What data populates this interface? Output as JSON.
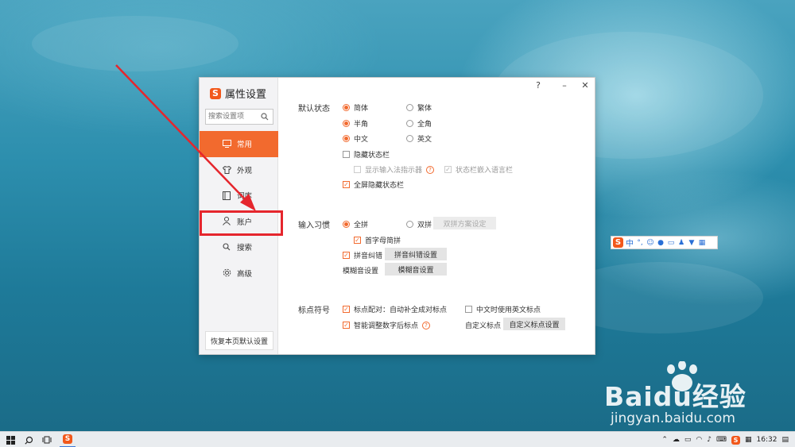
{
  "dialog": {
    "title": "属性设置",
    "help_label": "?",
    "minimize_label": "–",
    "close_label": "✕",
    "search_placeholder": "搜索设置项",
    "nav": [
      {
        "label": "常用",
        "icon": "monitor-icon"
      },
      {
        "label": "外观",
        "icon": "shirt-icon"
      },
      {
        "label": "词库",
        "icon": "book-icon"
      },
      {
        "label": "账户",
        "icon": "user-icon"
      },
      {
        "label": "搜索",
        "icon": "search-icon"
      },
      {
        "label": "高级",
        "icon": "gear-icon"
      }
    ],
    "restore_label": "恢复本页默认设置"
  },
  "default_state": {
    "title": "默认状态",
    "simplified": "简体",
    "traditional": "繁体",
    "half_width": "半角",
    "full_width": "全角",
    "chinese": "中文",
    "english": "英文",
    "hide_status_bar": "隐藏状态栏",
    "show_indicator": "显示输入法指示器",
    "embed_lang_bar": "状态栏嵌入语言栏",
    "fullscreen_hide": "全屏隐藏状态栏"
  },
  "input_habit": {
    "title": "输入习惯",
    "full_pinyin": "全拼",
    "double_pinyin": "双拼",
    "double_scheme_button": "双拼方案设定",
    "initial_abbrev": "首字母简拼",
    "pinyin_correction": "拼音纠错",
    "correction_button": "拼音纠错设置",
    "fuzzy_label": "模糊音设置",
    "fuzzy_button": "模糊音设置"
  },
  "punctuation": {
    "title": "标点符号",
    "auto_pair": "标点配对：自动补全成对标点",
    "english_in_chinese": "中文时使用英文标点",
    "smart_adjust": "智能调整数字后标点",
    "custom_label": "自定义标点",
    "custom_button": "自定义标点设置"
  },
  "ime_bar": {
    "mode": "中"
  },
  "watermark": {
    "brand": "Baidu经验",
    "url": "jingyan.baidu.com"
  },
  "taskbar": {
    "time": "16:32"
  }
}
